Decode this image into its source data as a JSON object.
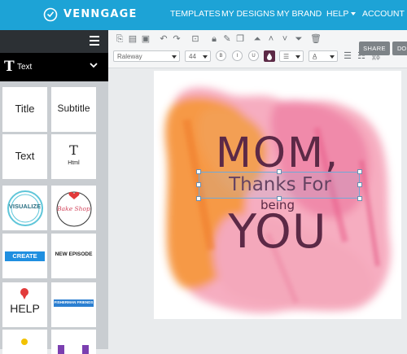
{
  "app": {
    "brand": "VENNGAGE",
    "nav": [
      {
        "label": "TEMPLATES"
      },
      {
        "label": "MY DESIGNS"
      },
      {
        "label": "MY BRAND"
      },
      {
        "label": "HELP"
      },
      {
        "label": "ACCOUNT"
      }
    ],
    "accent_color": "#1da3d6"
  },
  "sidebar": {
    "category_icon": "T",
    "category_label": "Text",
    "tiles": [
      {
        "label": "Title"
      },
      {
        "label": "Subtitle"
      },
      {
        "label": "Text"
      },
      {
        "label": "T",
        "sub": "Html"
      },
      {
        "label": "VISUALIZE"
      },
      {
        "label": "Bake Shop"
      },
      {
        "label": "CREATE"
      },
      {
        "label": "NEW EPISODE"
      },
      {
        "label": "HELP"
      },
      {
        "label": "FISHERMAN FRIENDS"
      }
    ]
  },
  "toolbar": {
    "font_family": "Raleway",
    "font_size": "44",
    "bold_label": "B",
    "italic_label": "I",
    "underline_label": "U",
    "color_swatch": "#5c2946",
    "share_label": "SHARE",
    "do_label": "DO"
  },
  "canvas": {
    "line1": "MOM,",
    "line2": "Thanks For",
    "line3": "being",
    "line4": "YOU",
    "text_color": "#5c2946"
  }
}
